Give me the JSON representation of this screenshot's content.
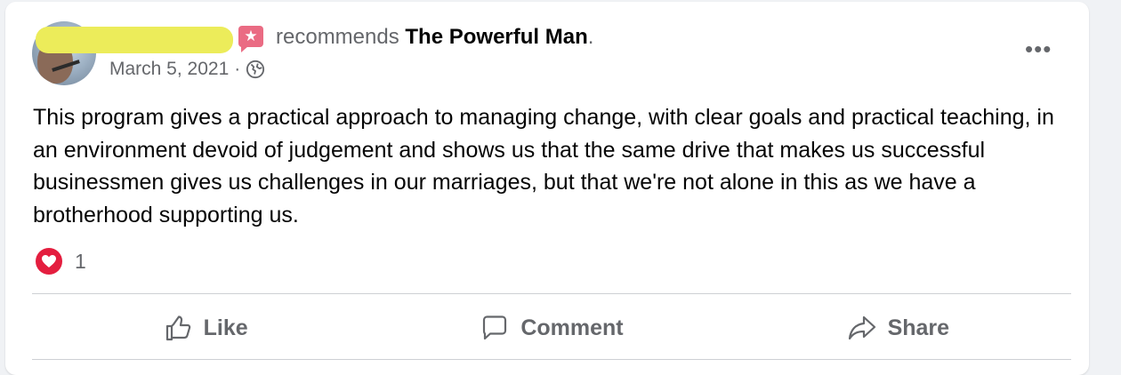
{
  "post": {
    "recommends_text": "recommends",
    "page_name": "The Powerful Man",
    "page_name_suffix": ".",
    "date": "March 5, 2021",
    "separator": "·",
    "more_label": "•••",
    "body": "This program gives a practical approach to managing change, with clear goals and practical teaching, in an environment devoid of judgement and shows us that the same drive that makes us successful businessmen gives us challenges in our marriages, but that we're not alone in this as we have a brotherhood supporting us.",
    "reactions": {
      "icon": "heart-icon",
      "count": "1"
    }
  },
  "actions": {
    "like": "Like",
    "comment": "Comment",
    "share": "Share"
  },
  "colors": {
    "secondary_text": "#65676b",
    "primary_text": "#050505",
    "heart": "#e41e3f",
    "badge": "#ea6b83",
    "redaction": "#ecec5a"
  }
}
